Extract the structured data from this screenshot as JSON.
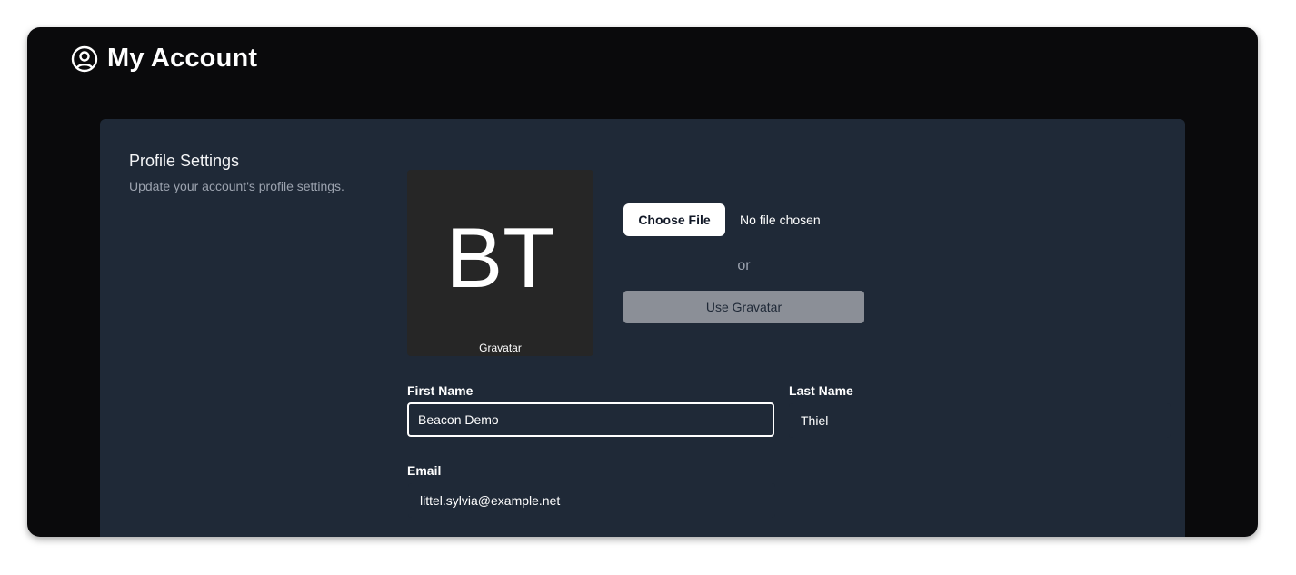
{
  "header": {
    "title": "My Account",
    "icon": "user-circle-icon"
  },
  "profile": {
    "title": "Profile Settings",
    "description": "Update your account's profile settings."
  },
  "avatar": {
    "initials": "BT",
    "caption": "Gravatar"
  },
  "upload": {
    "choose_file_label": "Choose File",
    "file_status": "No file chosen",
    "or_label": "or",
    "use_gravatar_label": "Use Gravatar"
  },
  "form": {
    "first_name": {
      "label": "First Name",
      "value": "Beacon Demo"
    },
    "last_name": {
      "label": "Last Name",
      "value": "Thiel"
    },
    "email": {
      "label": "Email",
      "value": "littel.sylvia@example.net"
    }
  },
  "colors": {
    "window_bg": "#0a0a0c",
    "card_bg": "#1f2937",
    "avatar_bg": "#262626",
    "gravatar_button_bg": "#8b8f97"
  }
}
